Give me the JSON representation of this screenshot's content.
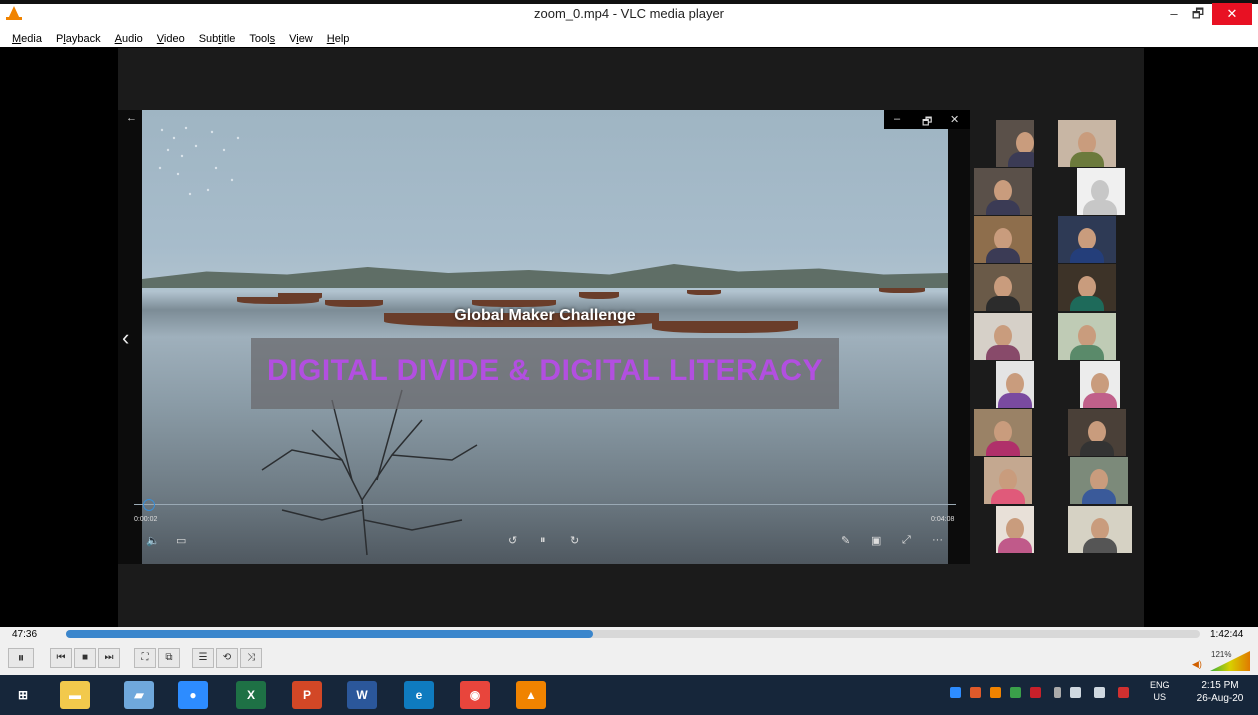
{
  "window": {
    "title": "zoom_0.mp4 - VLC media player",
    "minimize_glyph": "–",
    "maximize_glyph": "🗗",
    "close_glyph": "✕"
  },
  "menu": {
    "items": [
      {
        "label": "Media",
        "key": "M"
      },
      {
        "label": "Playback",
        "key": "l"
      },
      {
        "label": "Audio",
        "key": "A"
      },
      {
        "label": "Video",
        "key": "V"
      },
      {
        "label": "Subtitle",
        "key": "t"
      },
      {
        "label": "Tools",
        "key": "s"
      },
      {
        "label": "View",
        "key": "i"
      },
      {
        "label": "Help",
        "key": "H"
      }
    ]
  },
  "video": {
    "subtitle_line": "Global Maker Challenge",
    "headline": "DIGITAL DIVIDE & DIGITAL LITERACY",
    "inner_player": {
      "time_current": "0:00:02",
      "time_total": "0:04:08",
      "progress": 0.01,
      "ctrl_minimize": "–",
      "ctrl_restore": "🗗",
      "ctrl_close": "✕",
      "back_glyph": "←",
      "prev_glyph": "‹",
      "volume_glyph": "🔈",
      "cc_glyph": "▭",
      "rewind_glyph": "↺",
      "pause_glyph": "⏸",
      "forward_glyph": "↻",
      "pen_glyph": "✎",
      "miniview_glyph": "▣",
      "fullscreen_glyph": "⤢",
      "more_glyph": "···"
    }
  },
  "participants": {
    "count": 20
  },
  "player": {
    "time_elapsed": "47:36",
    "time_total": "1:42:44",
    "progress": 0.465,
    "volume_label": "121%",
    "buttons": {
      "pause": "⏸",
      "prev": "⏮",
      "stop": "■",
      "next": "⏭",
      "fullscreen": "⛶",
      "ext_settings": "⧉",
      "playlist": "☰",
      "loop": "⟲",
      "random": "⤨"
    }
  },
  "taskbar": {
    "apps": [
      {
        "name": "Windows",
        "glyph": "⊞",
        "color": "#16263a"
      },
      {
        "name": "File Explorer",
        "glyph": "▬",
        "color": "#f2c94c"
      },
      {
        "name": "Notebook",
        "glyph": "▰",
        "color": "#6fa8dc"
      },
      {
        "name": "Zoom",
        "glyph": "●",
        "color": "#2d8cff"
      },
      {
        "name": "Excel",
        "glyph": "X",
        "color": "#1e7145"
      },
      {
        "name": "PowerPoint",
        "glyph": "P",
        "color": "#d24726"
      },
      {
        "name": "Word",
        "glyph": "W",
        "color": "#2b579a"
      },
      {
        "name": "Edge",
        "glyph": "e",
        "color": "#0f7bbf"
      },
      {
        "name": "Chrome",
        "glyph": "◉",
        "color": "#e8453c"
      },
      {
        "name": "VLC",
        "glyph": "▲",
        "color": "#f08300"
      }
    ],
    "lang_top": "ENG",
    "lang_bottom": "US",
    "time": "2:15 PM",
    "date": "26-Aug-20"
  }
}
